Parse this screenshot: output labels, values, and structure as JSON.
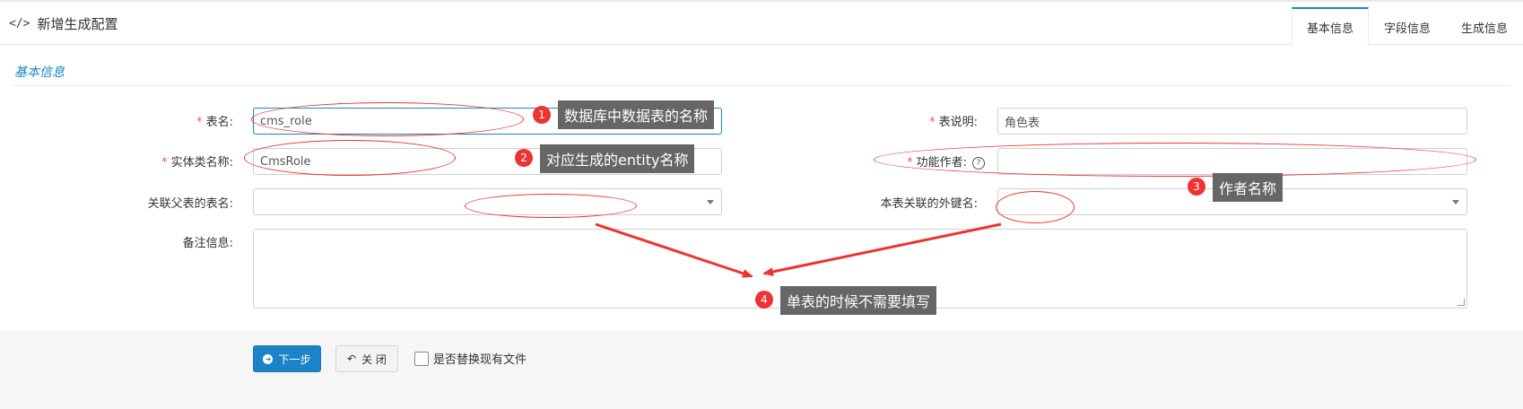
{
  "header": {
    "title": "新增生成配置",
    "icon": "code-icon"
  },
  "tabs": [
    {
      "label": "基本信息",
      "active": true
    },
    {
      "label": "字段信息",
      "active": false
    },
    {
      "label": "生成信息",
      "active": false
    }
  ],
  "section": {
    "title": "基本信息"
  },
  "form": {
    "table_name": {
      "label": "表名:",
      "value": "cms_role",
      "required": true
    },
    "entity_name": {
      "label": "实体类名称:",
      "value": "CmsRole",
      "required": true
    },
    "parent_table": {
      "label": "关联父表的表名:",
      "value": ""
    },
    "remarks": {
      "label": "备注信息:",
      "value": ""
    },
    "table_comment": {
      "label": "表说明:",
      "value": "角色表",
      "required": true
    },
    "author": {
      "label": "功能作者:",
      "value": "",
      "required": true
    },
    "foreign_key": {
      "label": "本表关联的外键名:",
      "value": ""
    },
    "required_mark": "*",
    "help_glyph": "?"
  },
  "footer": {
    "next_label": "下一步",
    "close_label": "关 闭",
    "replace_label": "是否替换现有文件"
  },
  "annotations": [
    {
      "number": "1",
      "text": "数据库中数据表的名称"
    },
    {
      "number": "2",
      "text": "对应生成的entity名称"
    },
    {
      "number": "3",
      "text": "作者名称"
    },
    {
      "number": "4",
      "text": "单表的时候不需要填写"
    }
  ],
  "colors": {
    "accent": "#1c84c6",
    "annotation": "#ee3333",
    "required": "#ed5565"
  }
}
